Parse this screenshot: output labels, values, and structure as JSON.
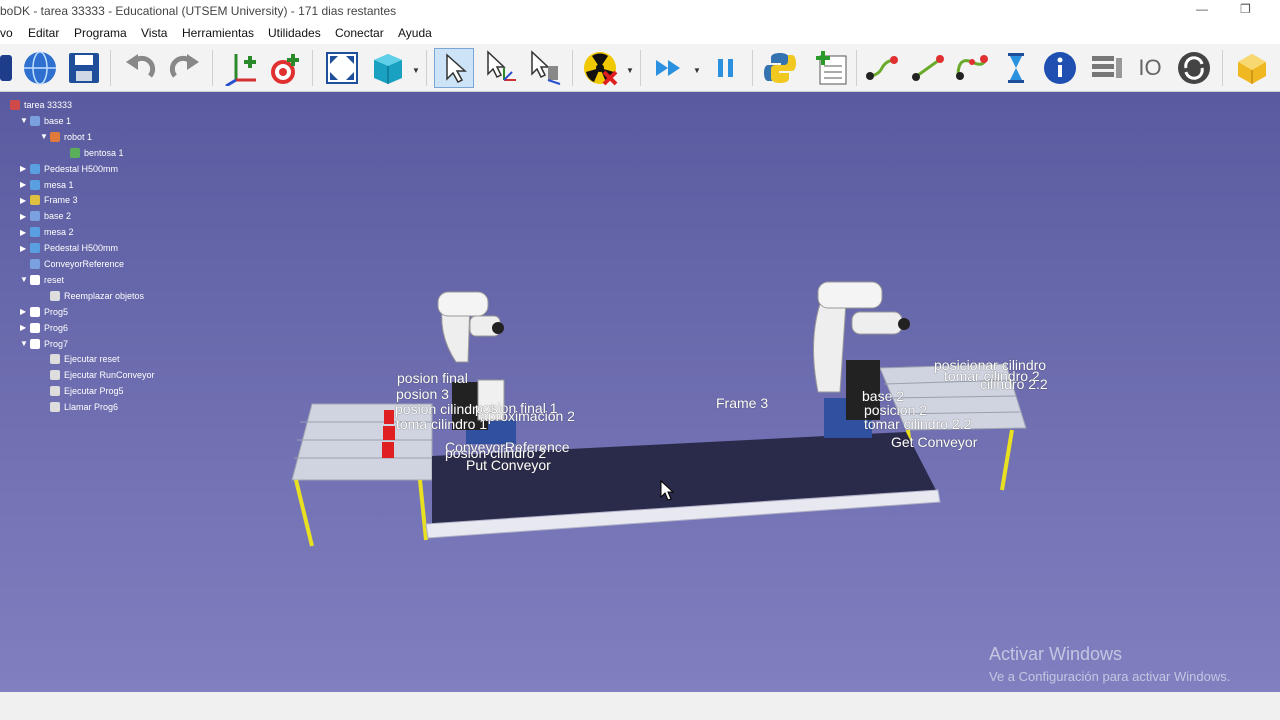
{
  "window": {
    "title": "boDK - tarea 33333 - Educational (UTSEM University) - 171 dias restantes",
    "minimize_glyph": "—",
    "restore_glyph": "❐"
  },
  "menu": [
    "vo",
    "Editar",
    "Programa",
    "Vista",
    "Herramientas",
    "Utilidades",
    "Conectar",
    "Ayuda"
  ],
  "toolbar": {
    "icons": [
      "robot-library-icon",
      "web-globe-icon",
      "save-icon",
      "undo-icon",
      "redo-icon",
      "add-reference-frame-icon",
      "add-target-icon",
      "fit-all-icon",
      "3d-view-icon",
      "select-icon",
      "move-reference-icon",
      "move-tool-icon",
      "collision-icon",
      "run-fast-icon",
      "pause-icon",
      "python-icon",
      "add-program-icon",
      "move-joint-icon",
      "move-linear-icon",
      "move-circular-icon",
      "pause-hourglass-icon",
      "info-icon",
      "program-list-icon",
      "io-icon",
      "refresh-icon",
      "package-icon"
    ],
    "io_label": "IO"
  },
  "tree": {
    "items": [
      {
        "label": "tarea 33333",
        "arrow": "",
        "icon": "station-icon",
        "color": "#d04a4a"
      },
      {
        "label": "base 1",
        "arrow": "▼",
        "icon": "reference-frame-icon",
        "color": "#7aa0e0"
      },
      {
        "label": "robot 1",
        "arrow": "▼",
        "icon": "robot-icon",
        "color": "#e07a3a"
      },
      {
        "label": "bentosa 1",
        "arrow": "",
        "icon": "tool-icon",
        "color": "#5ab05a"
      },
      {
        "label": "Pedestal H500mm",
        "arrow": "▶",
        "icon": "object-icon",
        "color": "#5aa0e0"
      },
      {
        "label": "mesa 1",
        "arrow": "▶",
        "icon": "object-icon",
        "color": "#5aa0e0"
      },
      {
        "label": "Frame 3",
        "arrow": "▶",
        "icon": "reference-frame-icon",
        "color": "#e0c040"
      },
      {
        "label": "base 2",
        "arrow": "▶",
        "icon": "reference-frame-icon",
        "color": "#7aa0e0"
      },
      {
        "label": "mesa 2",
        "arrow": "▶",
        "icon": "object-icon",
        "color": "#5aa0e0"
      },
      {
        "label": "Pedestal H500mm",
        "arrow": "▶",
        "icon": "object-icon",
        "color": "#5aa0e0"
      },
      {
        "label": "ConveyorReference",
        "arrow": "",
        "icon": "reference-frame-icon",
        "color": "#7aa0e0"
      },
      {
        "label": "reset",
        "arrow": "▼",
        "icon": "program-icon",
        "color": "#ffffff"
      },
      {
        "label": "Reemplazar objetos",
        "arrow": "",
        "icon": "instruction-icon",
        "color": "#dddddd"
      },
      {
        "label": "Prog5",
        "arrow": "▶",
        "icon": "program-icon",
        "color": "#ffffff"
      },
      {
        "label": "Prog6",
        "arrow": "▶",
        "icon": "program-icon",
        "color": "#ffffff"
      },
      {
        "label": "Prog7",
        "arrow": "▼",
        "icon": "program-icon",
        "color": "#ffffff"
      },
      {
        "label": "Ejecutar reset",
        "arrow": "",
        "icon": "instruction-icon",
        "color": "#dddddd"
      },
      {
        "label": "Ejecutar RunConveyor",
        "arrow": "",
        "icon": "instruction-icon",
        "color": "#dddddd"
      },
      {
        "label": "Ejecutar Prog5",
        "arrow": "",
        "icon": "instruction-icon",
        "color": "#dddddd"
      },
      {
        "label": "Llamar Prog6",
        "arrow": "",
        "icon": "instruction-icon",
        "color": "#dddddd"
      }
    ]
  },
  "scene_labels": [
    "posion final",
    "posion 3",
    "posion cilindro 1",
    "posion final 1",
    "toma cilindro 1",
    "aproximacion 2",
    "ConveyorReference",
    "posion cilindro 2",
    "Put Conveyor",
    "Frame 3",
    "posicionar cilindro",
    "tomar cilindro 2",
    "cilindro 2.2",
    "base 2",
    "posicion 2",
    "tomar cilindro 2.2",
    "Get Conveyor"
  ],
  "watermark": {
    "line1": "Activar Windows",
    "line2": "Ve a Configuración para activar Windows."
  },
  "colors": {
    "viewport_top": "#5a5aa0",
    "viewport_bottom": "#8080c0",
    "conveyor": "#2a2a4a",
    "table_legs": "#e8e020",
    "cylinders": "#e02020"
  }
}
